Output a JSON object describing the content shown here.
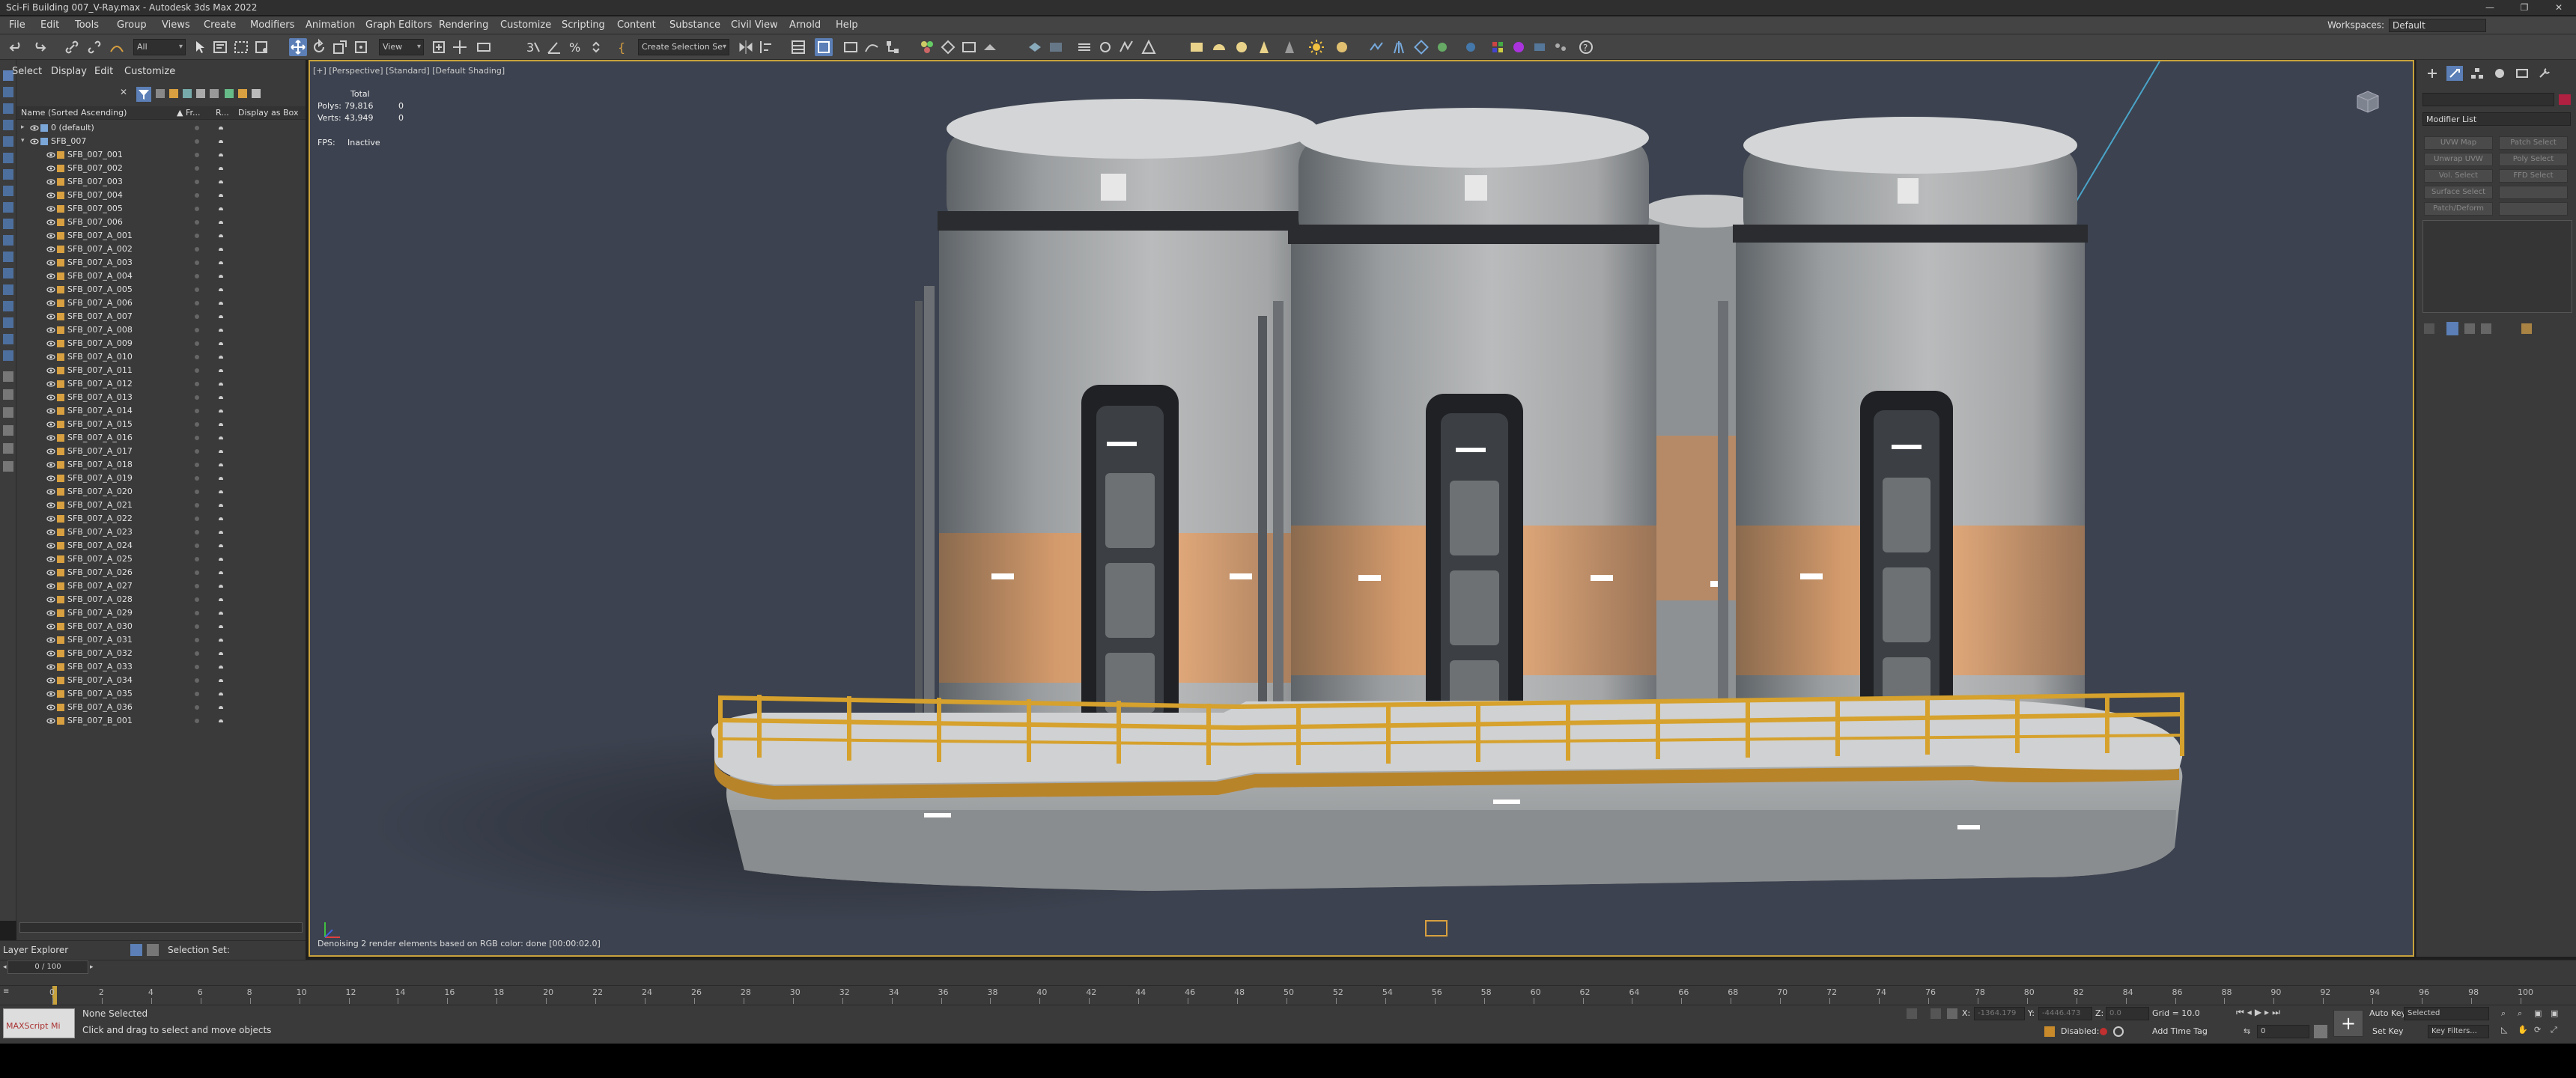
{
  "title": "Sci-Fi Building 007_V-Ray.max - Autodesk 3ds Max 2022",
  "window_buttons": [
    "—",
    "❐",
    "✕"
  ],
  "menu": [
    "File",
    "Edit",
    "Tools",
    "Group",
    "Views",
    "Create",
    "Modifiers",
    "Animation",
    "Graph Editors",
    "Rendering",
    "Customize",
    "Scripting",
    "Content",
    "Substance",
    "Civil View",
    "Arnold",
    "Help"
  ],
  "workspace": {
    "label": "Workspaces:",
    "value": "Default"
  },
  "toolbar": {
    "filter": "All",
    "view": "View",
    "selection_set": "Create Selection Se"
  },
  "scene_explorer": {
    "tabs": [
      "Select",
      "Display",
      "Edit",
      "Customize"
    ],
    "columns": {
      "name": "Name (Sorted Ascending)",
      "frozen": "▲ Fr...",
      "render": "R...",
      "display_box": "Display as Box"
    },
    "items": [
      "0 (default)",
      "SFB_007",
      "SFB_007_001",
      "SFB_007_002",
      "SFB_007_003",
      "SFB_007_004",
      "SFB_007_005",
      "SFB_007_006",
      "SFB_007_A_001",
      "SFB_007_A_002",
      "SFB_007_A_003",
      "SFB_007_A_004",
      "SFB_007_A_005",
      "SFB_007_A_006",
      "SFB_007_A_007",
      "SFB_007_A_008",
      "SFB_007_A_009",
      "SFB_007_A_010",
      "SFB_007_A_011",
      "SFB_007_A_012",
      "SFB_007_A_013",
      "SFB_007_A_014",
      "SFB_007_A_015",
      "SFB_007_A_016",
      "SFB_007_A_017",
      "SFB_007_A_018",
      "SFB_007_A_019",
      "SFB_007_A_020",
      "SFB_007_A_021",
      "SFB_007_A_022",
      "SFB_007_A_023",
      "SFB_007_A_024",
      "SFB_007_A_025",
      "SFB_007_A_026",
      "SFB_007_A_027",
      "SFB_007_A_028",
      "SFB_007_A_029",
      "SFB_007_A_030",
      "SFB_007_A_031",
      "SFB_007_A_032",
      "SFB_007_A_033",
      "SFB_007_A_034",
      "SFB_007_A_035",
      "SFB_007_A_036",
      "SFB_007_B_001"
    ],
    "layer_explorer": "Layer Explorer",
    "selection_set": "Selection Set:"
  },
  "viewport": {
    "label": "[+] [Perspective] [Standard] [Default Shading]",
    "stats": {
      "header": "Total",
      "polys_label": "Polys:",
      "polys": "79,816",
      "polys_sel": "0",
      "verts_label": "Verts:",
      "verts": "43,949",
      "verts_sel": "0"
    },
    "fps_label": "FPS:",
    "fps": "Inactive",
    "render_status": "Denoising 2 render elements based on RGB color: done [00:00:02.0]"
  },
  "command_panel": {
    "modifier_list": "Modifier List",
    "buttons": [
      "UVW Map",
      "Patch Select",
      "Unwrap UVW",
      "Poly Select",
      "Vol. Select",
      "FFD Select",
      "Surface Select",
      "",
      "Patch/Deform",
      ""
    ]
  },
  "timeline": {
    "slider": "0 / 100",
    "ticks": [
      "0",
      "2",
      "4",
      "6",
      "8",
      "10",
      "12",
      "14",
      "16",
      "18",
      "20",
      "22",
      "24",
      "26",
      "28",
      "30",
      "32",
      "34",
      "36",
      "38",
      "40",
      "42",
      "44",
      "46",
      "48",
      "50",
      "52",
      "54",
      "56",
      "58",
      "60",
      "62",
      "64",
      "66",
      "68",
      "70",
      "72",
      "74",
      "76",
      "78",
      "80",
      "82",
      "84",
      "86",
      "88",
      "90",
      "92",
      "94",
      "96",
      "98",
      "100"
    ]
  },
  "status": {
    "maxscript": "MAXScript Mi",
    "selection": "None Selected",
    "prompt": "Click and drag to select and move objects",
    "x_label": "X:",
    "x": "-1364.179",
    "y_label": "Y:",
    "y": "-4446.473",
    "z_label": "Z:",
    "z": "0.0",
    "grid": "Grid = 10.0",
    "disabled": "Disabled:",
    "add_time_tag": "Add Time Tag",
    "auto_key": "Auto Key",
    "set_key": "Set Key",
    "key_mode": "Selected",
    "key_filters": "Key Filters...",
    "frame": "0"
  },
  "colors": {
    "accent": "#5b7fb6",
    "viewport_border": "#c8a23c",
    "viewport_bg": "#3c424f",
    "railing": "#d6a12c",
    "panel_orange": "#e0a06a"
  }
}
